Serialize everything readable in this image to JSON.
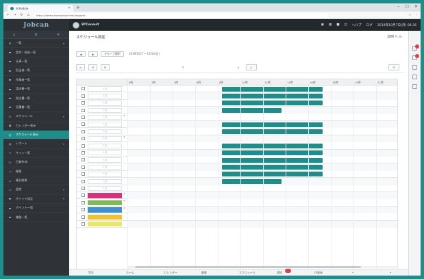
{
  "browser": {
    "tab_title": "Schedule",
    "url": "https://demo.example/schedule/gantt",
    "window_controls": [
      "–",
      "□",
      "✕"
    ],
    "nav": [
      "←",
      "→",
      "⟳",
      "⌂"
    ],
    "extensions": [
      "☆",
      "⋮"
    ]
  },
  "sidebar": {
    "logo": "Jobcan",
    "tools": [
      "⌂",
      "⚙",
      "✉"
    ],
    "items": [
      {
        "label": "一覧",
        "icon": "list-icon",
        "arrow": "▾"
      },
      {
        "label": "受付・指名一覧",
        "icon": "bars-icon"
      },
      {
        "label": "仕事一覧",
        "icon": "bars-icon"
      },
      {
        "label": "担当者一覧",
        "icon": "bars-icon"
      },
      {
        "label": "作業者一覧",
        "icon": "bars-icon"
      },
      {
        "label": "請求書一覧",
        "icon": "bars-icon"
      },
      {
        "label": "発注書一覧",
        "icon": "bars-icon"
      },
      {
        "label": "見積書一覧",
        "icon": "bars-icon"
      },
      {
        "label": "スケジュール",
        "icon": "clock-icon",
        "arrow": "▾"
      },
      {
        "label": "カレンダー表示",
        "icon": "calendar-icon"
      },
      {
        "label": "スケジュール表示",
        "icon": "clock-icon",
        "active": true
      },
      {
        "label": "レポート",
        "icon": "report-icon",
        "arrow": "▾"
      },
      {
        "label": "サイン一覧",
        "icon": "pen-icon"
      },
      {
        "label": "日報作成",
        "icon": "phone-icon"
      },
      {
        "label": "帳票",
        "icon": "doc-icon"
      },
      {
        "label": "集計結果",
        "icon": "doc-icon"
      },
      {
        "label": "設定",
        "icon": "doc-icon",
        "arrow": "▾"
      },
      {
        "label": "ポイント設定",
        "icon": "bars-icon",
        "arrow": "▾"
      },
      {
        "label": "ポイント一覧",
        "icon": "bars-icon"
      },
      {
        "label": "機能一覧",
        "icon": "bars-icon"
      }
    ]
  },
  "header": {
    "brand": "BTConsult",
    "icons": [
      "▣",
      "▦",
      "■",
      "◫"
    ],
    "link1": "ヘルプ",
    "link2": "ログ",
    "datetime": "2019年10月7日(月) 08:36"
  },
  "main": {
    "title": "スケジュール設定",
    "top_links": "説明 ✎ ⊡",
    "buttons1": [
      "◀",
      "▶",
      "グループ選択"
    ],
    "date_range": "2019/10/7 ~ 10/13(日)",
    "buttons2": [
      "≡",
      "⊡",
      "⊞",
      "✎",
      "◁",
      "▷",
      "⊟"
    ]
  },
  "gantt": {
    "hours": [
      "0時",
      "2時",
      "4時",
      "6時",
      "8時",
      "10時",
      "12時",
      "14時",
      "16時",
      "18時",
      "20時",
      "22時"
    ],
    "rows": [
      {
        "label": "人名",
        "bar": [
          0.345,
          0.717
        ]
      },
      {
        "label": "人名",
        "bar": [
          0.345,
          0.717
        ]
      },
      {
        "label": "人名",
        "bar": [
          0.345,
          0.717
        ]
      },
      {
        "label": "人名",
        "bar": [
          0.345,
          0.565
        ]
      },
      {
        "label": "人名",
        "star": true
      },
      {
        "label": "人名",
        "bar": [
          0.345,
          0.717
        ]
      },
      {
        "label": "人名",
        "bar": [
          0.345,
          0.717
        ]
      },
      {
        "label": "人名",
        "star": true
      },
      {
        "label": "人名",
        "bar": [
          0.345,
          0.717
        ]
      },
      {
        "label": "人名",
        "bar": [
          0.345,
          0.717
        ]
      },
      {
        "label": "人名",
        "bar": [
          0.345,
          0.717
        ]
      },
      {
        "label": "人名",
        "bar": [
          0.345,
          0.717
        ]
      },
      {
        "label": "人名",
        "bar": [
          0.345,
          0.717
        ]
      },
      {
        "label": "人名",
        "bar": [
          0.345,
          0.565
        ]
      },
      {
        "label": "人名"
      },
      {
        "label": "",
        "swatch": "#d9327a",
        "star": true
      },
      {
        "label": "",
        "swatch": "#7cbb55",
        "star": true
      },
      {
        "label": "",
        "swatch": "#3f8fd6",
        "star": true
      },
      {
        "label": "",
        "swatch": "#f2c12e"
      },
      {
        "label": "",
        "swatch": "#e8e96b"
      }
    ]
  },
  "bottom_nav": {
    "items": [
      "受注",
      "ホーム",
      "カレンダー",
      "顧客",
      "スケジュール",
      "通知",
      "作業者",
      "",
      ""
    ],
    "badge_index": 5
  },
  "colors": {
    "accent": "#1f8e8a",
    "sidebar_bg": "#2f3338",
    "header_bg": "#23282d",
    "badge": "#e04040"
  }
}
